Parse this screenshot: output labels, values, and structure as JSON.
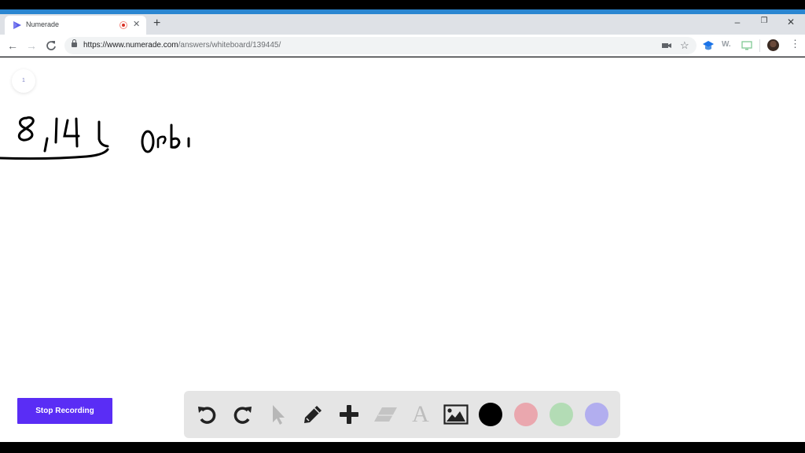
{
  "browser": {
    "tab": {
      "title": "Numerade",
      "recording": true
    },
    "new_tab_label": "+",
    "window_controls": {
      "minimize": "–",
      "restore": "❐",
      "close": "✕"
    },
    "nav": {
      "back": "←",
      "forward": "→",
      "reload": "C"
    },
    "url": {
      "host": "https://www.numerade.com",
      "path": "/answers/whiteboard/139445/"
    },
    "extensions": [
      "camera-icon",
      "star-icon",
      "graduation-cap-icon",
      "w-extension-icon",
      "monitor-icon",
      "avatar",
      "kebab-menu-icon"
    ],
    "ext_w_label": "W."
  },
  "whiteboard": {
    "page_number": "1",
    "handwriting": {
      "problem_number": "8,14",
      "text": "Orbi"
    },
    "stop_recording_label": "Stop Recording",
    "colors": {
      "brand": "#5a2df5",
      "black": "#000000",
      "pink": "#eaa7ae",
      "green": "#b3dcb5",
      "lavender": "#b2aeef"
    },
    "tools": [
      {
        "name": "undo",
        "enabled": true
      },
      {
        "name": "redo",
        "enabled": true
      },
      {
        "name": "select",
        "enabled": false
      },
      {
        "name": "pen",
        "enabled": true
      },
      {
        "name": "add",
        "enabled": true
      },
      {
        "name": "eraser",
        "enabled": false
      },
      {
        "name": "text",
        "enabled": false
      },
      {
        "name": "image",
        "enabled": true
      }
    ],
    "text_tool_glyph": "A"
  }
}
